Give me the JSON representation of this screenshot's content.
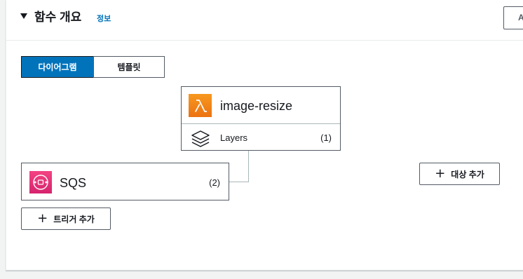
{
  "header": {
    "title": "함수 개요",
    "info_link": "정보",
    "action_button": "A"
  },
  "view_toggle": {
    "diagram": "다이어그램",
    "template": "템플릿",
    "selected": "diagram"
  },
  "function": {
    "name": "image-resize",
    "icon": "lambda-icon",
    "layers_label": "Layers",
    "layers_count": "(1)"
  },
  "trigger": {
    "name": "SQS",
    "icon": "sqs-icon",
    "count": "(2)"
  },
  "buttons": {
    "add_trigger": "트리거 추가",
    "add_destination": "대상 추가"
  },
  "colors": {
    "accent": "#0073bb",
    "lambda": "#ec7211",
    "sqs": "#e7157b",
    "border": "#545b64"
  }
}
